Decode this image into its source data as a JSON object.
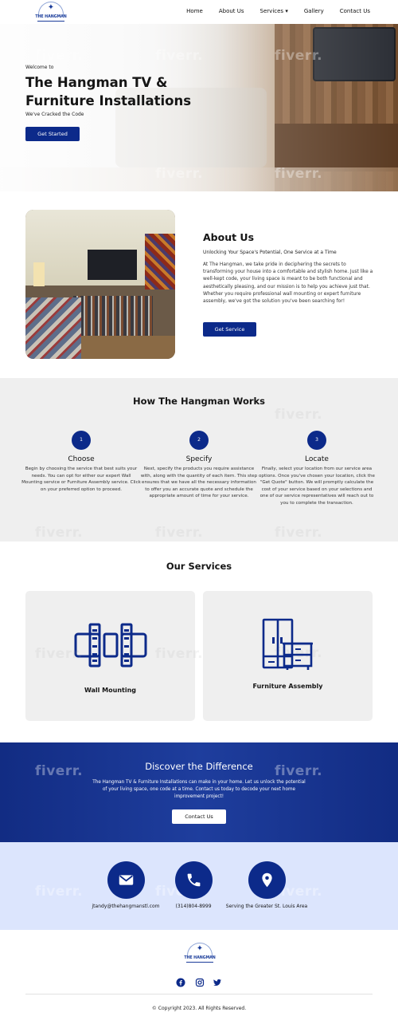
{
  "nav": {
    "logo_text": "THE HANGMAN",
    "links": [
      "Home",
      "About Us",
      "Services",
      "Gallery",
      "Contact Us"
    ],
    "services_caret": "▾"
  },
  "hero": {
    "welcome": "Welcome to",
    "title": "The Hangman TV & Furniture Installations",
    "tagline": "We've Cracked the Code",
    "cta": "Get Started"
  },
  "about": {
    "heading": "About Us",
    "subheading": "Unlocking Your Space's Potential, One Service at a Time",
    "body": "At The Hangman, we take pride in deciphering the secrets to transforming your house into a comfortable and stylish home. Just like a well-kept code, your living space is meant to be both functional and aesthetically pleasing, and our mission is to help you achieve just that. Whether you require professional wall mounting or expert furniture assembly, we've got the solution you've been searching for!",
    "cta": "Get Service"
  },
  "how": {
    "heading": "How The Hangman Works",
    "steps": [
      {
        "num": "1",
        "title": "Choose",
        "desc": "Begin by choosing the service that best suits your needs. You can opt for either our expert Wall Mounting service or Furniture Assembly service. Click on your preferred option to proceed."
      },
      {
        "num": "2",
        "title": "Specify",
        "desc": "Next, specify the products you require assistance with, along with the quantity of each item. This step ensures that we have all the necessary information to offer you an accurate quote and schedule the appropriate amount of time for your service."
      },
      {
        "num": "3",
        "title": "Locate",
        "desc": "Finally, select your location from our service area options. Once you've chosen your location, click the \"Get Quote\" button. We will promptly calculate the cost of your service based on your selections and one of our service representatives will reach out to you to complete the transaction."
      }
    ]
  },
  "services": {
    "heading": "Our Services",
    "items": [
      {
        "label": "Wall Mounting",
        "icon": "wall-mount-icon"
      },
      {
        "label": "Furniture Assembly",
        "icon": "furniture-icon"
      }
    ]
  },
  "discover": {
    "heading": "Discover the Difference",
    "body": "The Hangman TV & Furniture Installations can make in your home. Let us unlock the potential of your living space, one code at a time. Contact us today to decode your next home improvement project!",
    "cta": "Contact Us"
  },
  "contact": {
    "email": "jtandy@thehangmanstl.com",
    "phone": "(314)804-8999",
    "area": "Serving the Greater St. Louis Area"
  },
  "footer": {
    "logo_text": "THE HANGMAN",
    "socials": [
      "facebook-icon",
      "instagram-icon",
      "twitter-icon"
    ],
    "copyright": "© Copyright 2023. All Rights Reserved."
  },
  "watermark": "fiverr.",
  "colors": {
    "primary": "#0c2a8a",
    "light_bg": "#efefef",
    "contact_bg": "#dce5fd",
    "discover_bg": "#1a3a98"
  }
}
